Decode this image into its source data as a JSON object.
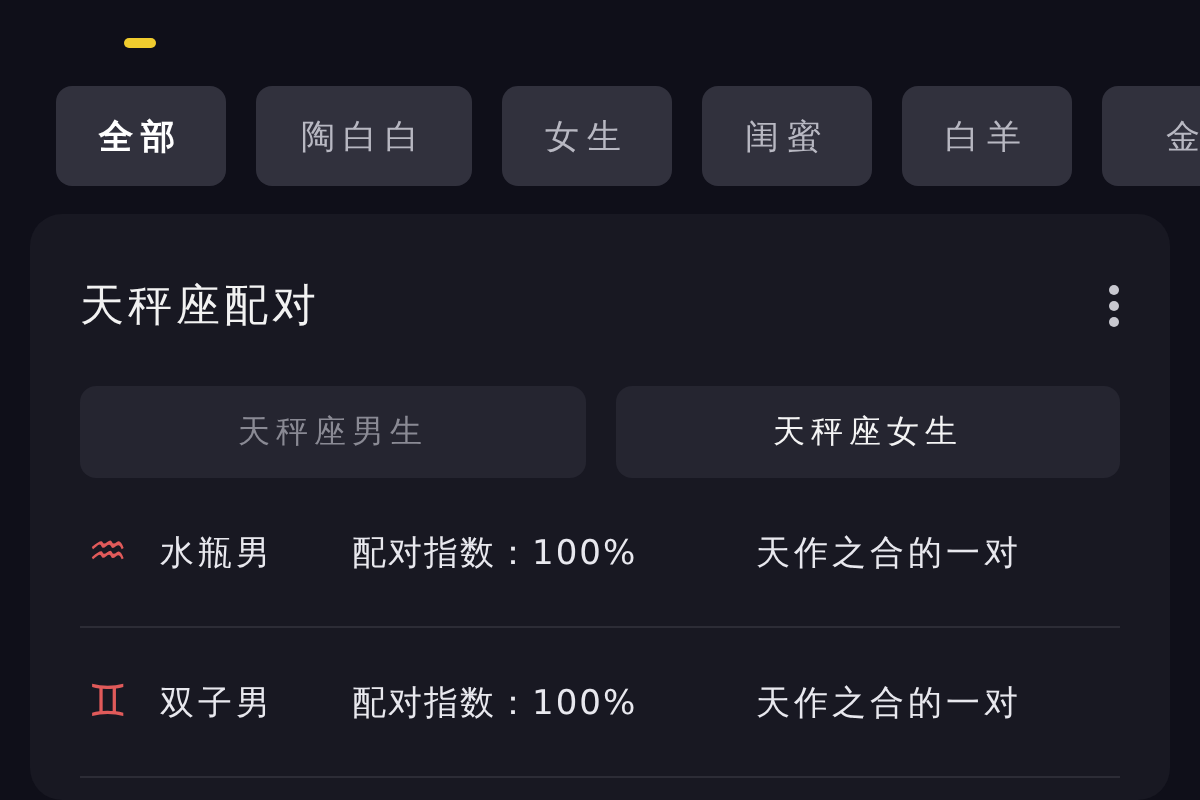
{
  "tabs": [
    {
      "label": "全部",
      "selected": true
    },
    {
      "label": "陶白白",
      "selected": false
    },
    {
      "label": "女生",
      "selected": false
    },
    {
      "label": "闺蜜",
      "selected": false
    },
    {
      "label": "白羊",
      "selected": false
    },
    {
      "label": "金",
      "selected": false
    }
  ],
  "card": {
    "title": "天秤座配对",
    "toggle": [
      {
        "label": "天秤座男生",
        "selected": false
      },
      {
        "label": "天秤座女生",
        "selected": true
      }
    ],
    "matches": [
      {
        "sign": "♒",
        "name": "水瓶男",
        "score": "配对指数：100%",
        "verdict": "天作之合的一对"
      },
      {
        "sign": "♊",
        "name": "双子男",
        "score": "配对指数：100%",
        "verdict": "天作之合的一对"
      }
    ]
  }
}
